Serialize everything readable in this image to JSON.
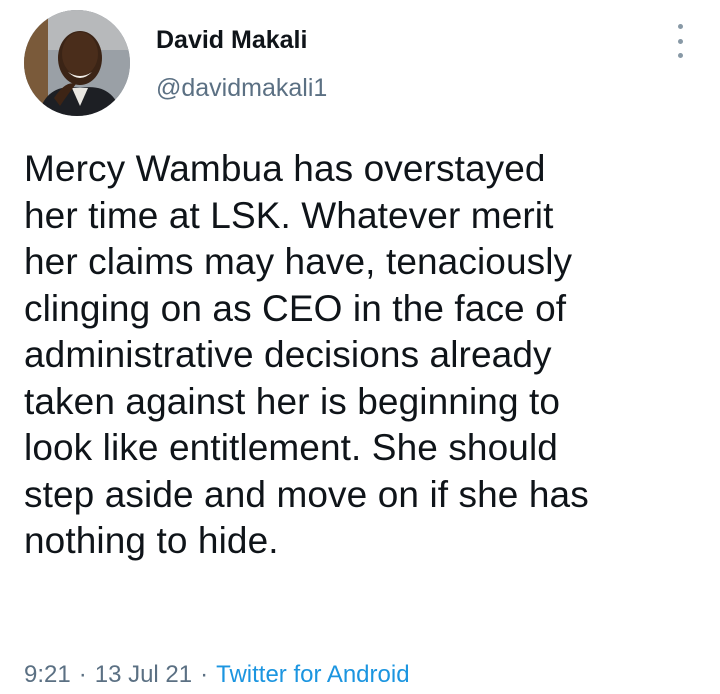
{
  "tweet": {
    "author": {
      "display_name": "David Makali",
      "handle": "@davidmakali1"
    },
    "text": "Mercy Wambua has overstayed\nher time at LSK. Whatever merit\nher claims may have, tenaciously\nclinging on as CEO in the face of\nadministrative decisions already\ntaken against her is beginning to\nlook like entitlement. She should\nstep aside and move on if she has\nnothing to hide.",
    "time": "9:21",
    "date": "13 Jul 21",
    "source": "Twitter for Android",
    "separator": "·",
    "more_icon": "more-vertical-icon"
  },
  "colors": {
    "text": "#0f1419",
    "secondary": "#5b7083",
    "link": "#1b95e0"
  }
}
